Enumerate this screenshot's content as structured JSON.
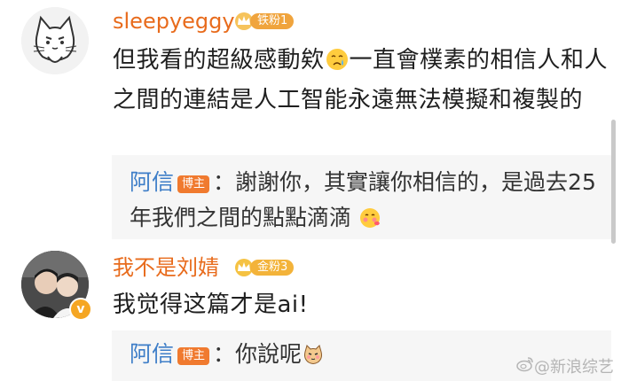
{
  "comments": [
    {
      "username": "sleepyeggy",
      "fan_badge": "铁粉1",
      "avatar_icon": "cat-avatar-icon",
      "text_before_emoji": "但我看的超級感動欸",
      "emoji_icon": "crying-face-icon",
      "text_after_emoji": "一直會樸素的相信人和人之間的連結是人工智能永遠無法模擬和複製的",
      "reply": {
        "author": "阿信",
        "author_badge": "博主",
        "separator": "：",
        "text": "謝謝你，其實讓你相信的，是過去25年我們之間的點點滴滴",
        "emoji_icon": "blushing-face-icon"
      }
    },
    {
      "username": "我不是刘婧",
      "fan_badge": "金粉3",
      "avatar_icon": "photo-avatar-icon",
      "verified_icon": "verified-v-icon",
      "verified_label": "v",
      "text": "我觉得这篇才是ai!",
      "reply": {
        "author": "阿信",
        "author_badge": "博主",
        "separator": "：",
        "text": "你說呢",
        "emoji_icon": "shy-cat-icon"
      }
    }
  ],
  "watermark": {
    "icon": "weibo-logo-icon",
    "text": "@新浪综艺"
  },
  "colors": {
    "username": "#e86b1c",
    "reply_author": "#3e7ec8",
    "blog_badge": "#f07a2f",
    "reply_bg": "#f6f6f6"
  }
}
